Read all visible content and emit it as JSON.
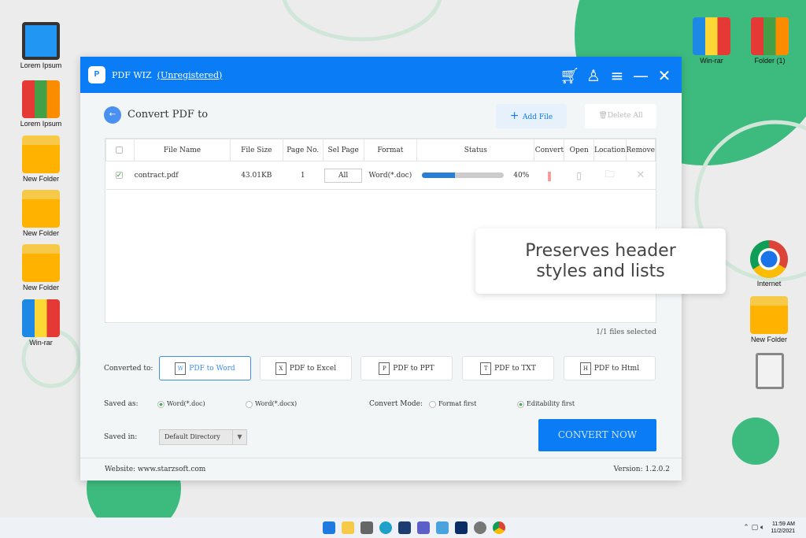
{
  "desktop": {
    "left_icons": [
      {
        "label": "Lorem Ipsum",
        "icon": "computer-icon"
      },
      {
        "label": "Lorem Ipsum",
        "icon": "books-icon"
      },
      {
        "label": "New Folder",
        "icon": "folder-icon"
      },
      {
        "label": "New Folder",
        "icon": "folder-icon"
      },
      {
        "label": "New Folder",
        "icon": "folder-icon"
      },
      {
        "label": "Win-rar",
        "icon": "winrar-icon"
      }
    ],
    "right_icons": [
      {
        "label": "Win-rar"
      },
      {
        "label": "Folder (1)"
      },
      {
        "label": "Internet"
      },
      {
        "label": "New Folder"
      }
    ]
  },
  "callout": {
    "text": "Preserves header styles and lists"
  },
  "app": {
    "name": "PDF WIZ",
    "registration": "(Unregistered)",
    "page_title": "Convert PDF to",
    "add_file": "Add File",
    "delete_all": "Delete All",
    "columns": [
      "File Name",
      "File Size",
      "Page No.",
      "Sel Page",
      "Format",
      "Status",
      "Convert",
      "Open",
      "Location",
      "Remove"
    ],
    "rows": [
      {
        "checked": true,
        "file_name": "contract.pdf",
        "file_size": "43.01KB",
        "page_no": "1",
        "sel_page": "All",
        "format": "Word(*.doc)",
        "progress": 40,
        "progress_label": "40%"
      }
    ],
    "selected_count": "1/1 files selected",
    "converted_to_label": "Converted to:",
    "formats": [
      {
        "label": "PDF to Word",
        "glyph": "W"
      },
      {
        "label": "PDF to Excel",
        "glyph": "X"
      },
      {
        "label": "PDF to PPT",
        "glyph": "P"
      },
      {
        "label": "PDF to TXT",
        "glyph": "T"
      },
      {
        "label": "PDF to Html",
        "glyph": "H"
      }
    ],
    "saved_as_label": "Saved as:",
    "saved_as_options": [
      "Word(*.doc)",
      "Word(*.docx)"
    ],
    "convert_mode_label": "Convert Mode:",
    "convert_mode_options": [
      "Format first",
      "Editability first"
    ],
    "saved_in_label": "Saved in:",
    "saved_in_value": "Default Directory",
    "convert_now": "CONVERT NOW",
    "website": "Website: www.starzsoft.com",
    "version": "Version: 1.2.0.2",
    "accent": "#0a7cf5"
  },
  "taskbar": {
    "time": "11:59 AM",
    "date": "11/2/2021"
  }
}
